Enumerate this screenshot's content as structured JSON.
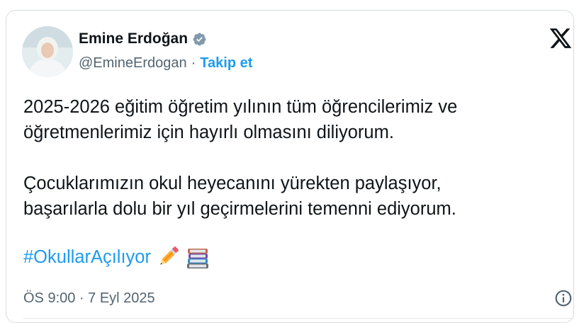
{
  "author": {
    "name": "Emine Erdoğan",
    "handle": "@EmineErdogan",
    "separator": "·",
    "follow_label": "Takip et"
  },
  "tweet": {
    "paragraph1_line1": "2025-2026 eğitim öğretim yılının tüm öğrencilerimiz ve",
    "paragraph1_line2": "öğretmenlerimiz için hayırlı olmasını diliyorum.",
    "paragraph2_line1": "Çocuklarımızın okul heyecanını yürekten paylaşıyor,",
    "paragraph2_line2": "başarılarla dolu bir yıl geçirmelerini temenni ediyorum.",
    "hashtag": "#OkullarAçılıyor",
    "emojis": [
      "pencil-emoji",
      "books-emoji"
    ]
  },
  "timestamp": "ÖS 9:00 · 7 Eyl 2025",
  "colors": {
    "accent": "#1d9bf0",
    "text": "#0f1419",
    "muted": "#536471",
    "border": "#d7dce0"
  },
  "icons": [
    "verified-badge-icon",
    "x-logo-icon",
    "info-icon"
  ]
}
